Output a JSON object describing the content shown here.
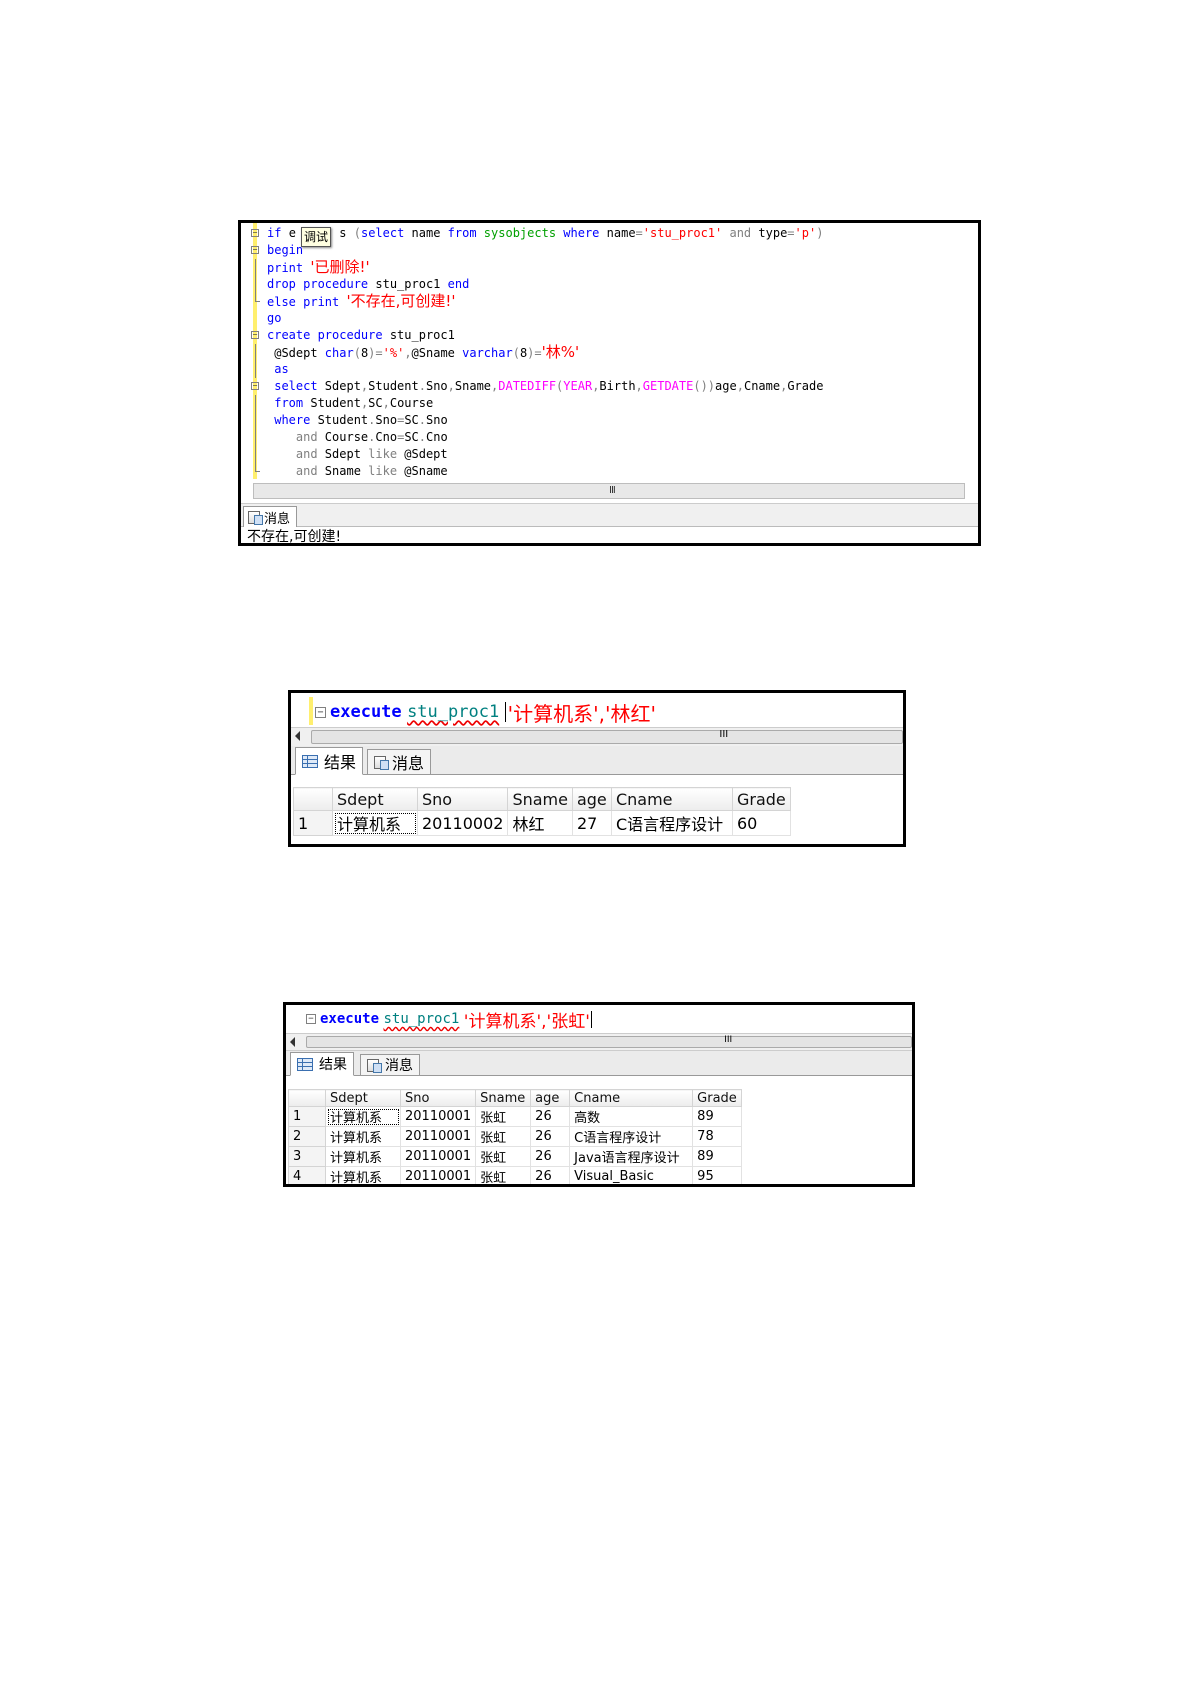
{
  "panel1": {
    "tooltip": "调试",
    "lines": [
      {
        "fold": "minus",
        "segs": [
          [
            "kw",
            "if "
          ],
          [
            "id",
            "e"
          ],
          [
            "pad",
            "      "
          ],
          [
            "id",
            "s "
          ],
          [
            "op",
            "("
          ],
          [
            "kw",
            "select "
          ],
          [
            "id",
            "name "
          ],
          [
            "kw",
            "from "
          ],
          [
            "sys",
            "sysobjects "
          ],
          [
            "kw",
            "where "
          ],
          [
            "id",
            "name"
          ],
          [
            "op",
            "="
          ],
          [
            "str",
            "'stu_proc1' "
          ],
          [
            "op",
            "and "
          ],
          [
            "id",
            "type"
          ],
          [
            "op",
            "="
          ],
          [
            "str",
            "'p'"
          ],
          [
            "op",
            ")"
          ]
        ]
      },
      {
        "fold": "minus",
        "segs": [
          [
            "kw",
            "begin"
          ]
        ]
      },
      {
        "fold": "line",
        "segs": [
          [
            "kw",
            "print "
          ],
          [
            "strcjk",
            "'已删除!'"
          ]
        ]
      },
      {
        "fold": "line",
        "segs": [
          [
            "kw",
            "drop procedure "
          ],
          [
            "id",
            "stu_proc1 "
          ],
          [
            "kw",
            "end"
          ]
        ]
      },
      {
        "fold": "end",
        "segs": [
          [
            "kw",
            "else print "
          ],
          [
            "strcjk",
            "'不存在,可创建!'"
          ]
        ]
      },
      {
        "fold": "none",
        "segs": [
          [
            "kw",
            "go"
          ]
        ]
      },
      {
        "fold": "minus",
        "segs": [
          [
            "kw",
            "create procedure "
          ],
          [
            "id",
            "stu_proc1"
          ]
        ]
      },
      {
        "fold": "line",
        "segs": [
          [
            "id",
            " @Sdept "
          ],
          [
            "kw",
            "char"
          ],
          [
            "op",
            "("
          ],
          [
            "id",
            "8"
          ],
          [
            "op",
            ")="
          ],
          [
            "str",
            "'%'"
          ],
          [
            "op",
            ","
          ],
          [
            "id",
            "@Sname "
          ],
          [
            "kw",
            "varchar"
          ],
          [
            "op",
            "("
          ],
          [
            "id",
            "8"
          ],
          [
            "op",
            ")="
          ],
          [
            "strcjk",
            "'林%'"
          ]
        ]
      },
      {
        "fold": "line",
        "segs": [
          [
            "kw",
            " as"
          ]
        ]
      },
      {
        "fold": "minus",
        "segs": [
          [
            "kw",
            " select "
          ],
          [
            "id",
            "Sdept"
          ],
          [
            "op",
            ","
          ],
          [
            "id",
            "Student"
          ],
          [
            "op",
            "."
          ],
          [
            "id",
            "Sno"
          ],
          [
            "op",
            ","
          ],
          [
            "id",
            "Sname"
          ],
          [
            "op",
            ","
          ],
          [
            "fn",
            "DATEDIFF"
          ],
          [
            "op",
            "("
          ],
          [
            "fn",
            "YEAR"
          ],
          [
            "op",
            ","
          ],
          [
            "id",
            "Birth"
          ],
          [
            "op",
            ","
          ],
          [
            "fn",
            "GETDATE"
          ],
          [
            "op",
            "())"
          ],
          [
            "id",
            "age"
          ],
          [
            "op",
            ","
          ],
          [
            "id",
            "Cname"
          ],
          [
            "op",
            ","
          ],
          [
            "id",
            "Grade"
          ]
        ]
      },
      {
        "fold": "line",
        "segs": [
          [
            "kw",
            " from "
          ],
          [
            "id",
            "Student"
          ],
          [
            "op",
            ","
          ],
          [
            "id",
            "SC"
          ],
          [
            "op",
            ","
          ],
          [
            "id",
            "Course"
          ]
        ]
      },
      {
        "fold": "line",
        "segs": [
          [
            "kw",
            " where "
          ],
          [
            "id",
            "Student"
          ],
          [
            "op",
            "."
          ],
          [
            "id",
            "Sno"
          ],
          [
            "op",
            "="
          ],
          [
            "id",
            "SC"
          ],
          [
            "op",
            "."
          ],
          [
            "id",
            "Sno"
          ]
        ]
      },
      {
        "fold": "line",
        "segs": [
          [
            "op",
            "    and "
          ],
          [
            "id",
            "Course"
          ],
          [
            "op",
            "."
          ],
          [
            "id",
            "Cno"
          ],
          [
            "op",
            "="
          ],
          [
            "id",
            "SC"
          ],
          [
            "op",
            "."
          ],
          [
            "id",
            "Cno"
          ]
        ]
      },
      {
        "fold": "line",
        "segs": [
          [
            "op",
            "    and "
          ],
          [
            "id",
            "Sdept "
          ],
          [
            "op",
            "like "
          ],
          [
            "id",
            "@Sdept"
          ]
        ]
      },
      {
        "fold": "end",
        "segs": [
          [
            "op",
            "    and "
          ],
          [
            "id",
            "Sname "
          ],
          [
            "op",
            "like "
          ],
          [
            "id",
            "@Sname"
          ]
        ]
      }
    ],
    "scroll_grip": "III",
    "messages_tab": "消息",
    "message_text": "不存在,可创建!"
  },
  "panel2": {
    "exec_keyword": "execute",
    "proc_name": "stu_proc1",
    "args": "'计算机系','林红'",
    "scroll_grip": "III",
    "tab_results": "结果",
    "tab_messages": "消息",
    "columns": [
      "",
      "Sdept",
      "Sno",
      "Sname",
      "age",
      "Cname",
      "Grade"
    ],
    "rows": [
      [
        "1",
        "计算机系",
        "20110002",
        "林红",
        "27",
        "C语言程序设计",
        "60"
      ]
    ]
  },
  "panel3": {
    "exec_keyword": "execute",
    "proc_name": "stu_proc1",
    "args": "'计算机系','张虹'",
    "scroll_grip": "III",
    "tab_results": "结果",
    "tab_messages": "消息",
    "columns": [
      "",
      "Sdept",
      "Sno",
      "Sname",
      "age",
      "Cname",
      "Grade"
    ],
    "rows": [
      [
        "1",
        "计算机系",
        "20110001",
        "张虹",
        "26",
        "高数",
        "89"
      ],
      [
        "2",
        "计算机系",
        "20110001",
        "张虹",
        "26",
        "C语言程序设计",
        "78"
      ],
      [
        "3",
        "计算机系",
        "20110001",
        "张虹",
        "26",
        "Java语言程序设计",
        "89"
      ],
      [
        "4",
        "计算机系",
        "20110001",
        "张虹",
        "26",
        "Visual_Basic",
        "95"
      ]
    ]
  }
}
